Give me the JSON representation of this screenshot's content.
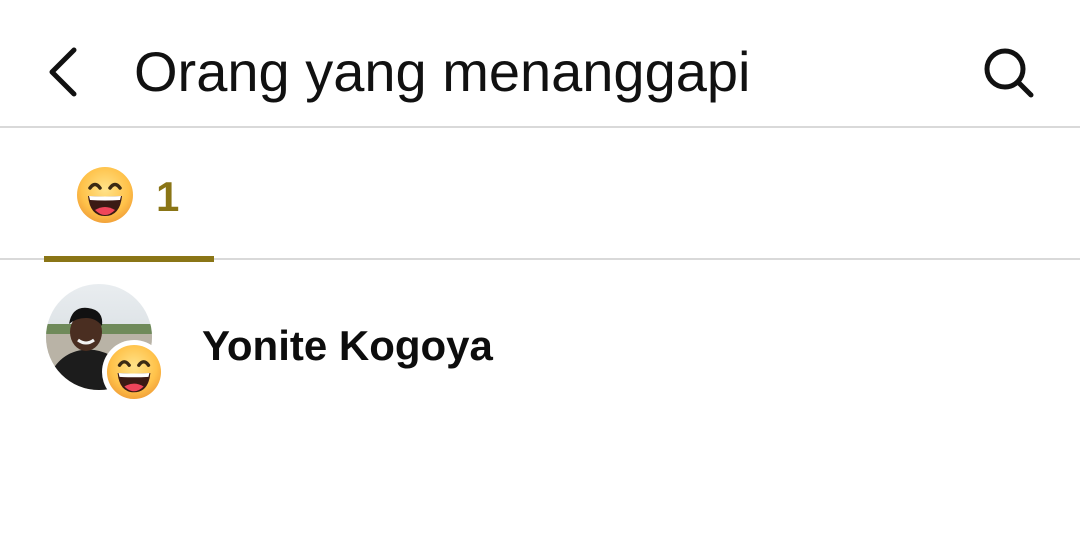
{
  "header": {
    "title": "Orang yang menanggapi",
    "back_icon": "chevron-left-icon",
    "search_icon": "search-icon"
  },
  "tabs": [
    {
      "icon": "laughing-emoji-icon",
      "count": "1",
      "active": true
    }
  ],
  "colors": {
    "accent": "#8a7516",
    "divider": "#d9d9d9",
    "text": "#111111"
  },
  "reactions": [
    {
      "name": "Yonite Kogoya",
      "reaction_icon": "laughing-emoji-icon"
    }
  ]
}
